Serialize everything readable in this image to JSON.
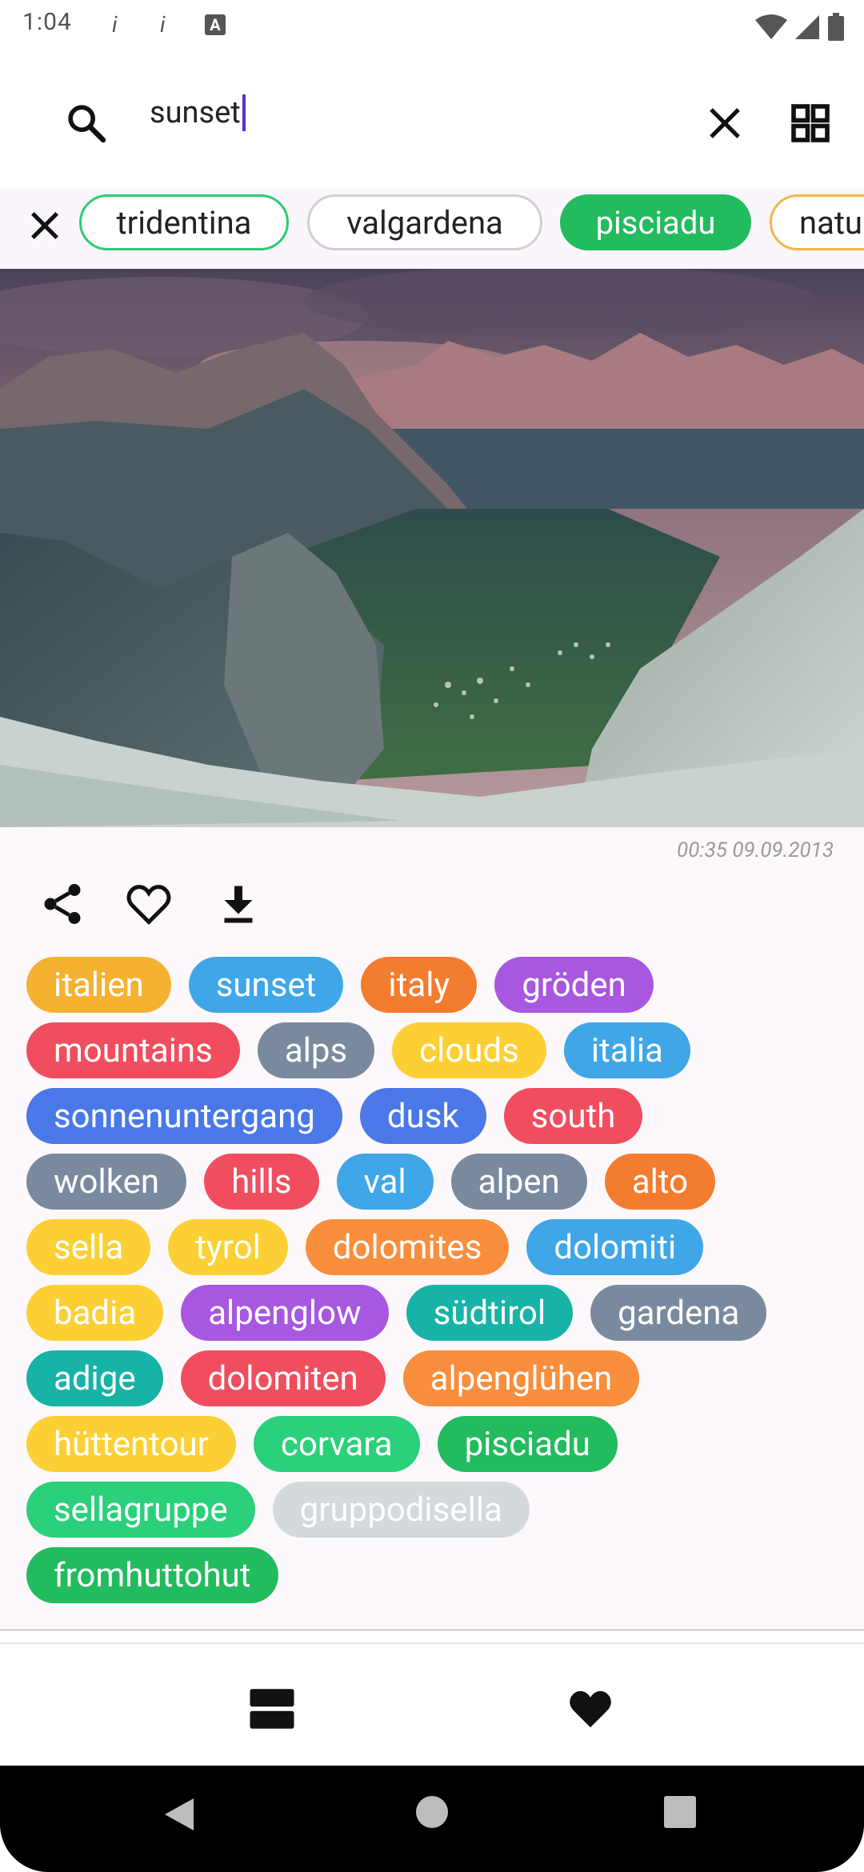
{
  "status": {
    "time": "1:04",
    "icons": [
      "info-icon",
      "info-icon",
      "font-icon",
      "wifi-icon",
      "cell-signal-icon",
      "battery-icon"
    ]
  },
  "search": {
    "query": "sunset"
  },
  "filter_chips": [
    {
      "label": "tridentina",
      "style": "outline-green"
    },
    {
      "label": "valgardena",
      "style": "outline-grey"
    },
    {
      "label": "pisciadu",
      "style": "filled-green"
    },
    {
      "label": "natu",
      "style": "outline-orange"
    }
  ],
  "photo": {
    "timestamp": "00:35 09.09.2013"
  },
  "tags": [
    [
      {
        "label": "italien",
        "color": "#f5b130"
      },
      {
        "label": "sunset",
        "color": "#3fa6e8"
      },
      {
        "label": "italy",
        "color": "#f47c2f"
      },
      {
        "label": "gröden",
        "color": "#a857e0"
      }
    ],
    [
      {
        "label": "mountains",
        "color": "#f04e5e"
      },
      {
        "label": "alps",
        "color": "#7a8a9e"
      },
      {
        "label": "clouds",
        "color": "#fcd035"
      },
      {
        "label": "italia",
        "color": "#3fa6e8"
      }
    ],
    [
      {
        "label": "sonnenuntergang",
        "color": "#4a78e8"
      },
      {
        "label": "dusk",
        "color": "#4a78e8"
      },
      {
        "label": "south",
        "color": "#f04e5e"
      }
    ],
    [
      {
        "label": "wolken",
        "color": "#7a8a9e"
      },
      {
        "label": "hills",
        "color": "#f04e5e"
      },
      {
        "label": "val",
        "color": "#3fa6e8"
      },
      {
        "label": "alpen",
        "color": "#7a8a9e"
      },
      {
        "label": "alto",
        "color": "#f47c2f"
      }
    ],
    [
      {
        "label": "sella",
        "color": "#fcd035"
      },
      {
        "label": "tyrol",
        "color": "#fcd035"
      },
      {
        "label": "dolomites",
        "color": "#f98e3c"
      },
      {
        "label": "dolomiti",
        "color": "#3fa6e8"
      }
    ],
    [
      {
        "label": "badia",
        "color": "#fcd035"
      },
      {
        "label": "alpenglow",
        "color": "#a857e0"
      },
      {
        "label": "südtirol",
        "color": "#16b3a6"
      },
      {
        "label": "gardena",
        "color": "#7a8a9e"
      }
    ],
    [
      {
        "label": "adige",
        "color": "#16b3a6"
      },
      {
        "label": "dolomiten",
        "color": "#f04e5e"
      },
      {
        "label": "alpenglühen",
        "color": "#f98e3c"
      }
    ],
    [
      {
        "label": "hüttentour",
        "color": "#fcd035"
      },
      {
        "label": "corvara",
        "color": "#2bd07a"
      },
      {
        "label": "pisciadu",
        "color": "#22bb5e"
      }
    ],
    [
      {
        "label": "sellagruppe",
        "color": "#2bd07a"
      },
      {
        "label": "gruppodisella",
        "color": "#d4d9de"
      }
    ],
    [
      {
        "label": "fromhuttohut",
        "color": "#22bb5e"
      }
    ]
  ],
  "bottom_nav": {
    "items": [
      "list-view-icon",
      "favorites-heart-icon"
    ]
  }
}
